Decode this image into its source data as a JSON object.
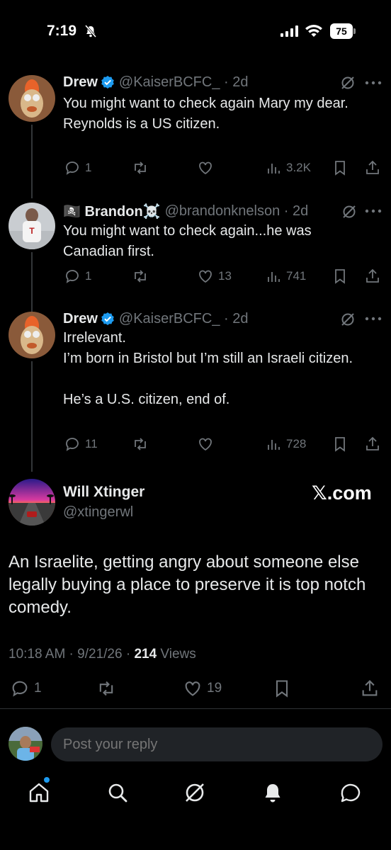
{
  "status_bar": {
    "time": "7:19",
    "battery": "75"
  },
  "replies": [
    {
      "name": "Drew",
      "verified": true,
      "handle": "@KaiserBCFC_ · 2d",
      "text": [
        "You might want to check again Mary my dear.",
        "Reynolds is a US citizen."
      ],
      "replies": "1",
      "reposts": "",
      "likes": "",
      "views": "3.2K"
    },
    {
      "name": "🏴‍☠️ Brandon☠️",
      "verified": false,
      "handle": "@brandonknelson · 2d",
      "text": [
        "You might want to check again...he was Canadian first."
      ],
      "replies": "1",
      "reposts": "",
      "likes": "13",
      "views": "741"
    },
    {
      "name": "Drew",
      "verified": true,
      "handle": "@KaiserBCFC_ · 2d",
      "text": [
        "Irrelevant.",
        "I’m born in Bristol but I’m still an Israeli citizen.",
        "",
        "He’s a U.S. citizen, end of."
      ],
      "replies": "11",
      "reposts": "",
      "likes": "",
      "views": "728"
    }
  ],
  "main_tweet": {
    "name": "Will Xtinger",
    "handle": "@xtingerwl",
    "source_badge": "𝕏.com",
    "text": "An Israelite, getting angry about someone else legally buying a place to preserve it  is top notch comedy.",
    "time": "10:18 AM · 9/21/26 · ",
    "views_count": "214",
    "views_label": " Views",
    "replies": "1",
    "likes": "19"
  },
  "reply_box": {
    "placeholder": "Post your reply"
  },
  "nav": {
    "items": [
      "home-icon",
      "search-icon",
      "grok-icon",
      "notifications-icon",
      "messages-icon"
    ]
  },
  "colors": {
    "background": "#000000",
    "text": "#e7e9ea",
    "muted": "#71767b",
    "accent": "#1d9bf0"
  }
}
